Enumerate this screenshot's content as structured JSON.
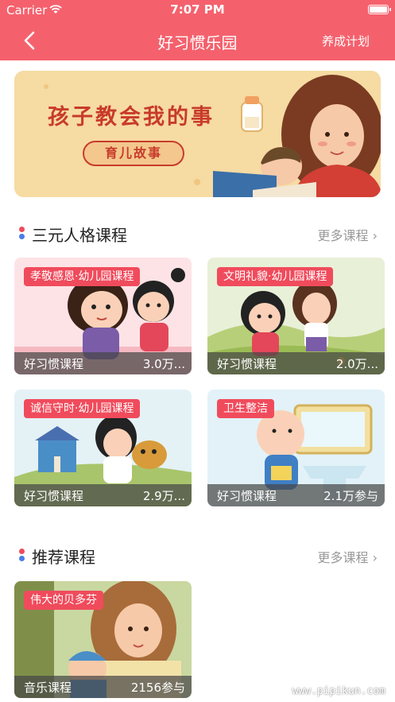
{
  "status_bar": {
    "carrier": "Carrier",
    "time": "7:07 PM"
  },
  "navbar": {
    "title": "好习惯乐园",
    "right_label": "养成计划"
  },
  "banner": {
    "headline": "孩子教会我的事",
    "subtitle": "育儿故事"
  },
  "section1": {
    "title": "三元人格课程",
    "more": "更多课程",
    "cards": [
      {
        "tag": "孝敬感恩·幼儿园课程",
        "category": "好习惯课程",
        "count": "3.0万..."
      },
      {
        "tag": "文明礼貌·幼儿园课程",
        "category": "好习惯课程",
        "count": "2.0万..."
      },
      {
        "tag": "诚信守时·幼儿园课程",
        "category": "好习惯课程",
        "count": "2.9万..."
      },
      {
        "tag": "卫生整洁",
        "category": "好习惯课程",
        "count": "2.1万参与"
      }
    ]
  },
  "section2": {
    "title": "推荐课程",
    "more": "更多课程",
    "cards": [
      {
        "tag": "伟大的贝多芬",
        "category": "音乐课程",
        "count": "2156参与"
      }
    ]
  },
  "colors": {
    "brand": "#f4616d",
    "tag": "#f04b5c",
    "dot_red": "#f04b5c",
    "dot_blue": "#4a7de8"
  },
  "watermark": "www.pipikun.com"
}
